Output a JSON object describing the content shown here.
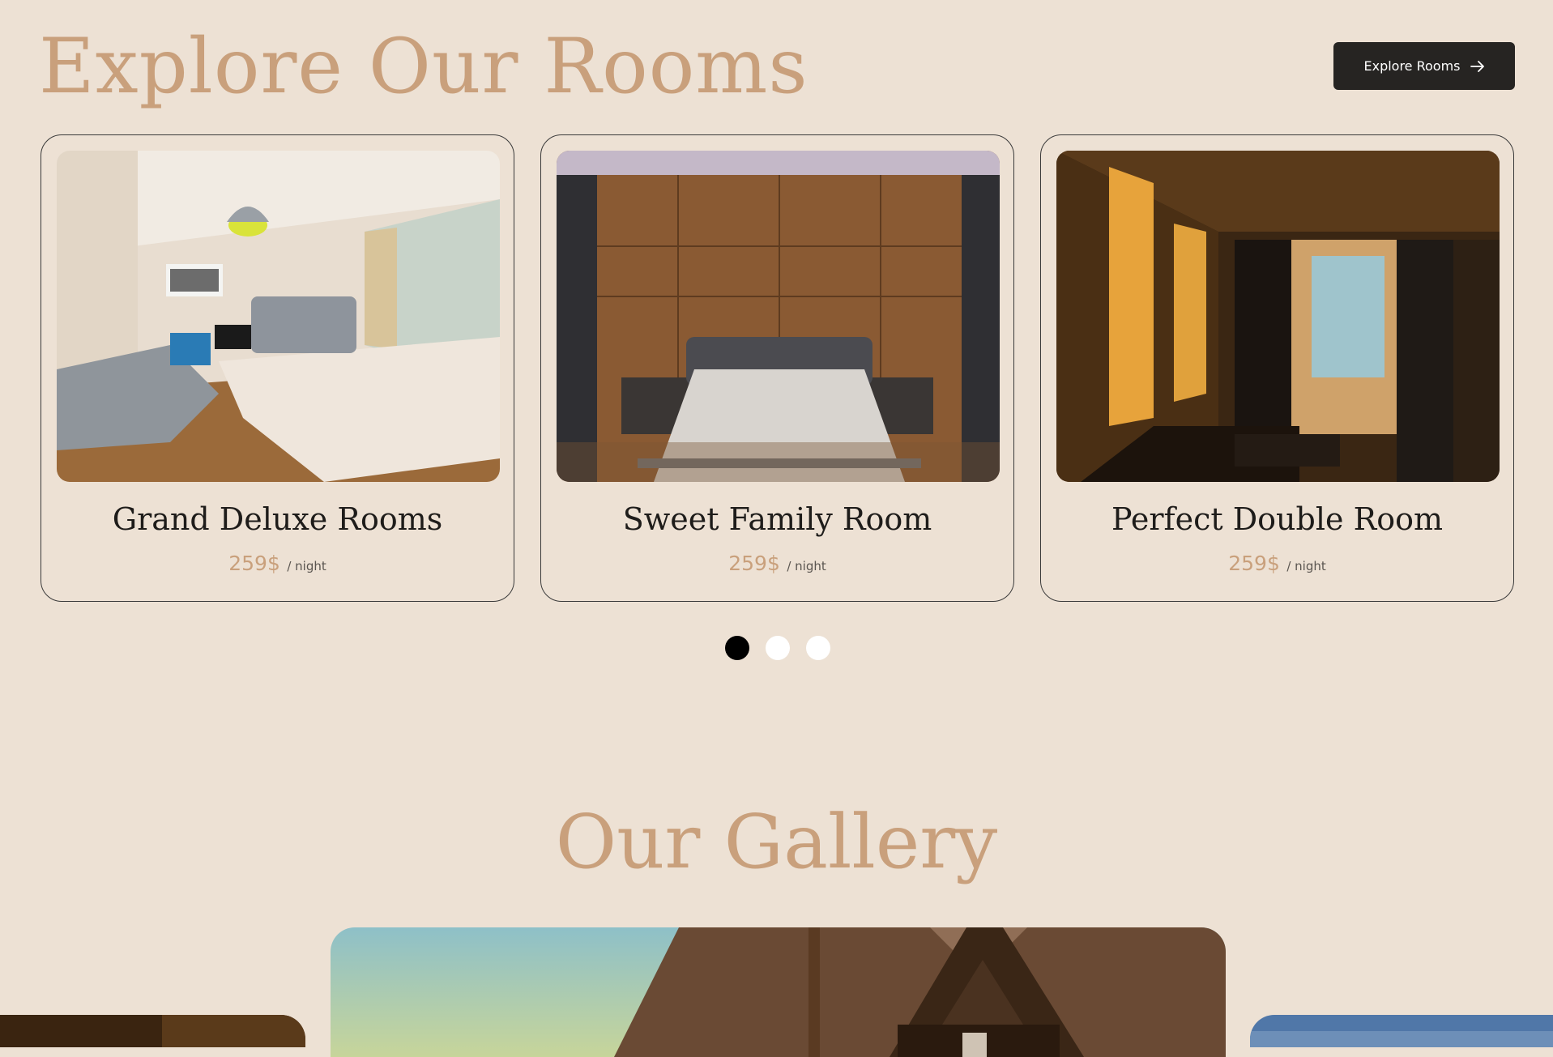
{
  "header": {
    "title": "Explore Our Rooms",
    "button_label": "Explore Rooms",
    "button_icon": "arrow-right-icon"
  },
  "rooms": [
    {
      "name": "Grand Deluxe Rooms",
      "price": "259$",
      "unit": "/ night"
    },
    {
      "name": "Sweet Family Room",
      "price": "259$",
      "unit": "/ night"
    },
    {
      "name": "Perfect Double Room",
      "price": "259$",
      "unit": "/ night"
    }
  ],
  "pager": {
    "total": 3,
    "active": 1
  },
  "gallery": {
    "title": "Our Gallery"
  },
  "colors": {
    "background": "#ede1d4",
    "accent": "#c9a07c",
    "button": "#262422",
    "text": "#1e1c1a"
  }
}
